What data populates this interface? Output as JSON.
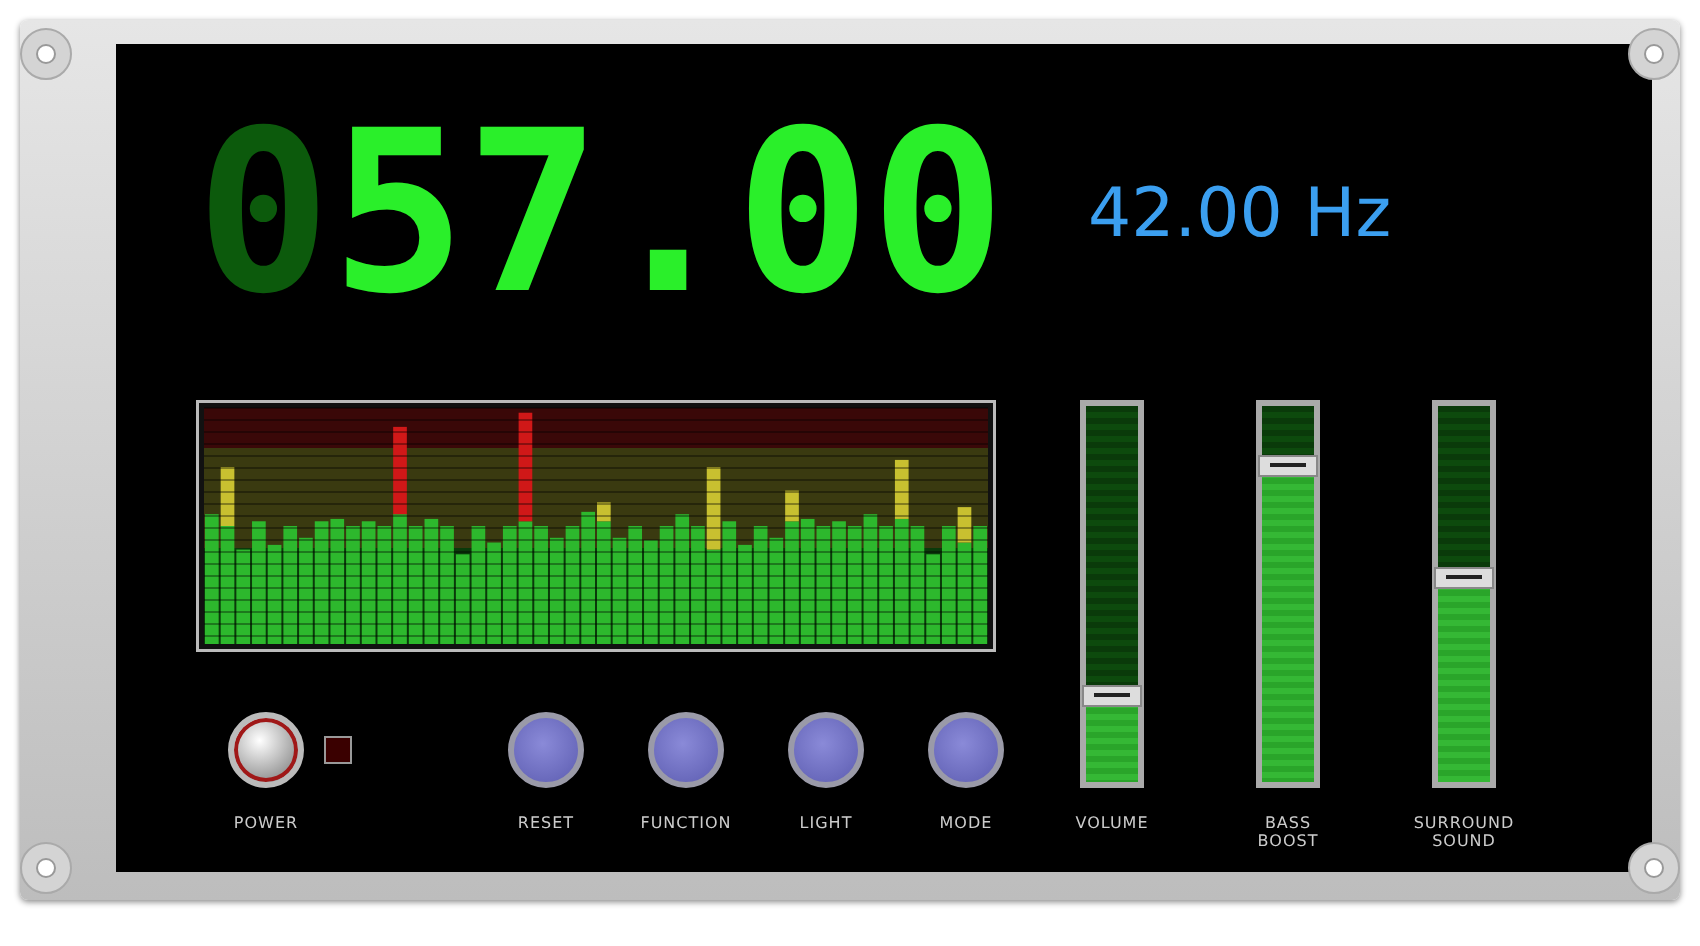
{
  "display": {
    "digits": [
      {
        "char": "0",
        "lit": false
      },
      {
        "char": "5",
        "lit": true
      },
      {
        "char": "7",
        "lit": true
      },
      {
        "char": ".",
        "lit": true
      },
      {
        "char": "0",
        "lit": true
      },
      {
        "char": "0",
        "lit": true
      }
    ],
    "frequency": "42.00 Hz"
  },
  "power": {
    "label": "POWER",
    "led_on": false
  },
  "buttons": [
    {
      "label": "RESET"
    },
    {
      "label": "FUNCTION"
    },
    {
      "label": "LIGHT"
    },
    {
      "label": "MODE"
    }
  ],
  "sliders": [
    {
      "label": "VOLUME",
      "level": 0.23
    },
    {
      "label": "BASS\nBOOST",
      "level": 0.84
    },
    {
      "label": "SURROUND\nSOUND",
      "level": 0.54
    }
  ]
}
